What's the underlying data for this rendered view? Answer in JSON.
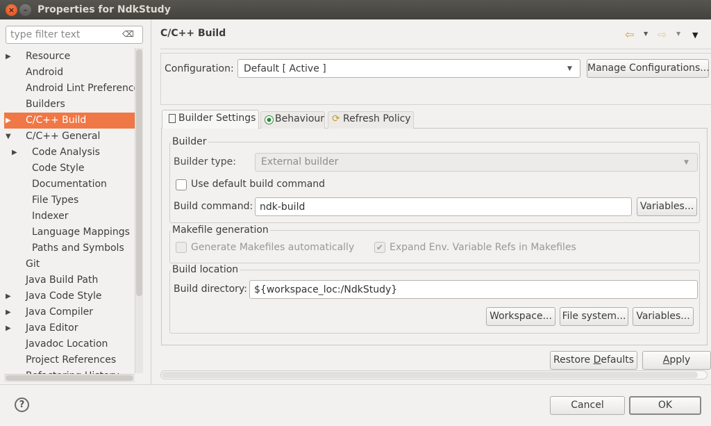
{
  "window": {
    "title": "Properties for NdkStudy",
    "close_glyph": "×",
    "minimize_glyph": "–"
  },
  "filter": {
    "placeholder": "type filter text",
    "clear_icon": "⌫"
  },
  "tree": {
    "items": [
      {
        "label": "Resource",
        "expander": "▶"
      },
      {
        "label": "Android",
        "expander": ""
      },
      {
        "label": "Android Lint Preferences",
        "expander": ""
      },
      {
        "label": "Builders",
        "expander": ""
      },
      {
        "label": "C/C++ Build",
        "expander": "▶"
      },
      {
        "label": "C/C++ General",
        "expander": "▼"
      },
      {
        "label": "Code Analysis",
        "expander": "▶"
      },
      {
        "label": "Code Style",
        "expander": ""
      },
      {
        "label": "Documentation",
        "expander": ""
      },
      {
        "label": "File Types",
        "expander": ""
      },
      {
        "label": "Indexer",
        "expander": ""
      },
      {
        "label": "Language Mappings",
        "expander": ""
      },
      {
        "label": "Paths and Symbols",
        "expander": ""
      },
      {
        "label": "Git",
        "expander": ""
      },
      {
        "label": "Java Build Path",
        "expander": ""
      },
      {
        "label": "Java Code Style",
        "expander": "▶"
      },
      {
        "label": "Java Compiler",
        "expander": "▶"
      },
      {
        "label": "Java Editor",
        "expander": "▶"
      },
      {
        "label": "Javadoc Location",
        "expander": ""
      },
      {
        "label": "Project References",
        "expander": ""
      },
      {
        "label": "Refactoring History",
        "expander": ""
      }
    ],
    "selected_label": "C/C++ Build"
  },
  "page": {
    "title": "C/C++ Build",
    "back_icon": "⇦",
    "forward_icon": "⇨",
    "dropdown_glyph": "▼"
  },
  "configuration": {
    "label": "Configuration:",
    "value": "Default  [ Active ]",
    "manage_button": "Manage Configurations..."
  },
  "tabs": [
    {
      "label": "Builder Settings",
      "active": true
    },
    {
      "label": "Behaviour",
      "active": false
    },
    {
      "label": "Refresh Policy",
      "active": false
    }
  ],
  "refresh_icon_glyph": "⟳",
  "builder": {
    "group_title": "Builder",
    "type_label": "Builder type:",
    "type_value": "External builder",
    "use_default_label": "Use default build command",
    "use_default_checked": false,
    "command_label": "Build command:",
    "command_value": "ndk-build",
    "variables_button": "Variables..."
  },
  "makefile": {
    "group_title": "Makefile generation",
    "generate_label": "Generate Makefiles automatically",
    "generate_checked": false,
    "expand_env_label": "Expand Env. Variable Refs in Makefiles",
    "expand_env_checked": true,
    "check_glyph": "✔"
  },
  "location": {
    "group_title": "Build location",
    "directory_label": "Build directory:",
    "directory_value": "${workspace_loc:/NdkStudy}",
    "workspace_button": "Workspace...",
    "filesystem_button": "File system...",
    "variables_button": "Variables..."
  },
  "actions": {
    "restore_pre": "Restore ",
    "restore_mnemonic": "D",
    "restore_post": "efaults",
    "apply_mnemonic": "A",
    "apply_post": "pply"
  },
  "footer": {
    "help_glyph": "?",
    "cancel": "Cancel",
    "ok": "OK"
  }
}
